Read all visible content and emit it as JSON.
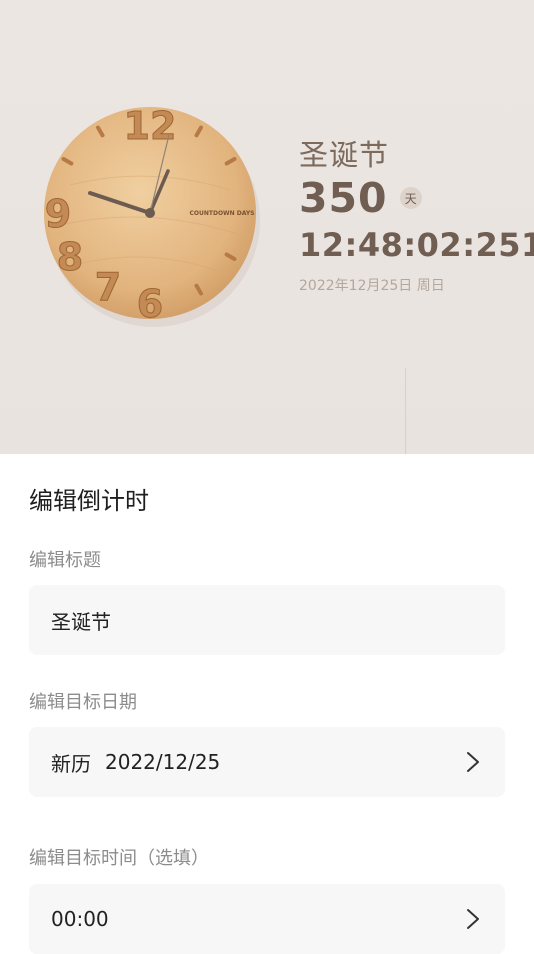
{
  "hero": {
    "event_title": "圣诞节",
    "days_remaining": "350",
    "days_unit": "天",
    "time_remaining": "12:48:02:251",
    "target_date": "2022年12月25日 周日",
    "clock": {
      "brand_text": "COUNTDOWN DAYS",
      "numerals": [
        "12",
        "9",
        "6",
        "7",
        "8"
      ]
    }
  },
  "sheet": {
    "title": "编辑倒计时",
    "title_label": "编辑标题",
    "title_value": "圣诞节",
    "date_label": "编辑目标日期",
    "calendar_type": "新历",
    "date_value": "2022/12/25",
    "time_label": "编辑目标时间（选填）",
    "time_value": "00:00"
  },
  "colors": {
    "hero_bg": "#ebe5e1",
    "accent_brown": "#6f5e51",
    "field_bg": "#f7f7f7"
  }
}
